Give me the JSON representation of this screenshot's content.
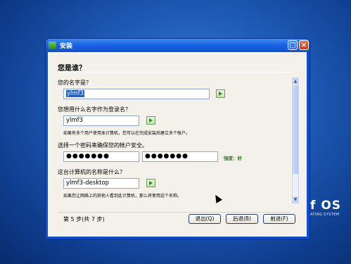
{
  "window": {
    "title": "安装",
    "maximize_glyph": "□",
    "close_glyph": "×"
  },
  "page": {
    "heading": "您是谁？"
  },
  "name": {
    "label": "您的名字是？",
    "value": "ylmf3"
  },
  "login": {
    "label": "您想用什么名字作为登录名？",
    "value": "ylmf3",
    "hint": "如果有多个用户使用本计算机，您可以在完成安装后建立多个帐户。"
  },
  "password": {
    "label": "选择一个密码来确保您的帐户安全。",
    "value": "●●●●●●●",
    "confirm_value": "●●●●●●●",
    "strength": "强度：好"
  },
  "computer": {
    "label": "这台计算机的名称是什么？",
    "value": "ylmf3-desktop",
    "hint": "如果您让网络上的其他人看到此计算机，那么将使用这个名称。"
  },
  "footer": {
    "step": "第 5 步(共 7 步)"
  },
  "buttons": {
    "quit": "退出(Q)",
    "back": "后退(B)",
    "forward": "前进(F)"
  },
  "scrollbar": {
    "up_glyph": "▲",
    "down_glyph": "▼"
  },
  "desktop": {
    "brand": "f OS",
    "brand_sub": "ATING SYSTEM"
  },
  "icons": [
    "installer-icon",
    "maximize-icon",
    "close-icon",
    "go-arrow-icon",
    "mouse-cursor-icon"
  ]
}
